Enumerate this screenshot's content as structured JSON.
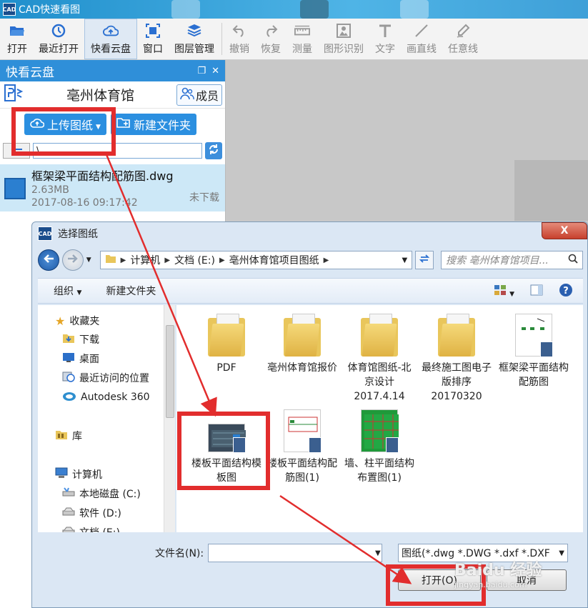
{
  "window": {
    "title": "CAD快速看图",
    "icon": "CAD"
  },
  "toolbar": {
    "items": [
      {
        "label": "打开",
        "icon": "folder-open-icon",
        "active": false,
        "disabled": false
      },
      {
        "label": "最近打开",
        "icon": "history-icon",
        "active": false,
        "disabled": false
      },
      {
        "label": "快看云盘",
        "icon": "cloud-icon",
        "active": true,
        "disabled": false
      },
      {
        "label": "窗口",
        "icon": "window-icon",
        "active": false,
        "disabled": false
      },
      {
        "label": "图层管理",
        "icon": "layers-icon",
        "active": false,
        "disabled": false
      },
      {
        "label": "撤销",
        "icon": "undo-icon",
        "active": false,
        "disabled": true
      },
      {
        "label": "恢复",
        "icon": "redo-icon",
        "active": false,
        "disabled": true
      },
      {
        "label": "测量",
        "icon": "ruler-icon",
        "active": false,
        "disabled": true
      },
      {
        "label": "图形识别",
        "icon": "shape-recognize-icon",
        "active": false,
        "disabled": true
      },
      {
        "label": "文字",
        "icon": "text-icon",
        "active": false,
        "disabled": true
      },
      {
        "label": "画直线",
        "icon": "line-icon",
        "active": false,
        "disabled": true
      },
      {
        "label": "任意线",
        "icon": "pen-icon",
        "active": false,
        "disabled": true
      }
    ]
  },
  "cloud_panel": {
    "title": "快看云盘",
    "folder_title": "亳州体育馆",
    "member_label": "成员",
    "upload_label": "上传图纸",
    "new_folder_label": "新建文件夹",
    "path_value": "\\",
    "files": [
      {
        "name": "框架梁平面结构配筋图.dwg",
        "size": "2.63MB",
        "time": "2017-08-16 09:17:42",
        "status": "未下载"
      }
    ]
  },
  "dialog": {
    "title": "选择图纸",
    "close_label": "X",
    "breadcrumb": [
      "计算机",
      "文档 (E:)",
      "亳州体育馆项目图纸"
    ],
    "search_placeholder": "搜索 亳州体育馆项目...",
    "organize_label": "组织",
    "new_folder_label": "新建文件夹",
    "nav": {
      "favorites": "收藏夹",
      "downloads": "下载",
      "desktop": "桌面",
      "recent": "最近访问的位置",
      "autodesk": "Autodesk 360",
      "libraries": "库",
      "computer": "计算机",
      "drive_c": "本地磁盘 (C:)",
      "drive_d": "软件 (D:)",
      "drive_e": "文档 (E:)"
    },
    "items": [
      {
        "name": "PDF",
        "kind": "folder"
      },
      {
        "name": "亳州体育馆报价",
        "kind": "folder"
      },
      {
        "name": "体育馆图纸-北京设计2017.4.14",
        "kind": "folder"
      },
      {
        "name": "最终施工图电子版排序20170320",
        "kind": "folder"
      },
      {
        "name": "框架梁平面结构配筋图",
        "kind": "dwg"
      },
      {
        "name": "楼板平面结构模板图",
        "kind": "dwg"
      },
      {
        "name": "楼板平面结构配筋图(1)",
        "kind": "dwg"
      },
      {
        "name": "墙、柱平面结构布置图(1)",
        "kind": "dwg"
      }
    ],
    "filename_label": "文件名(N):",
    "filename_value": "",
    "filter_value": "图纸(*.dwg *.DWG *.dxf *.DXF",
    "open_label": "打开(O)",
    "cancel_label": "取消"
  },
  "watermark": {
    "brand": "Baidu 经验",
    "url": "jingyan.baidu.com"
  },
  "colors": {
    "accent": "#2f8fd9",
    "annotation": "#e22d2d",
    "selected_row": "#cde8f7"
  }
}
